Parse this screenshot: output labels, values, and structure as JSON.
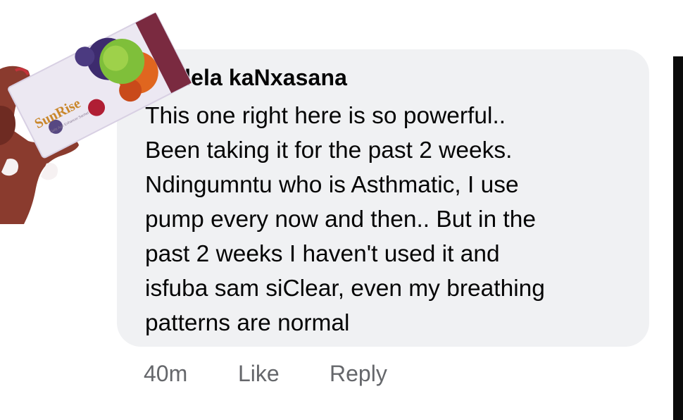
{
  "comment": {
    "author": "Ndlela kaNxasana",
    "author_visible": "‘‘ndlela kaNxasana",
    "lines": [
      "This one right here is so powerful..",
      "Been taking it for the past 2 weeks.",
      "Ndingumntu who is Asthmatic, I use",
      "pump every now and then.. But in the",
      "past 2 weeks I haven't used it and",
      "isfuba sam siClear, even my breathing",
      "patterns are normal"
    ],
    "time": "40m",
    "like_label": "Like",
    "reply_label": "Reply"
  },
  "avatar": {
    "brand": "SunRise",
    "subtitle": "Daily Age Enhancer Sachet"
  },
  "colors": {
    "bubble": "#f0f1f3",
    "text": "#050505",
    "secondary": "#65676b",
    "product_box": "#ece8f2",
    "brand_text": "#c9872b"
  }
}
